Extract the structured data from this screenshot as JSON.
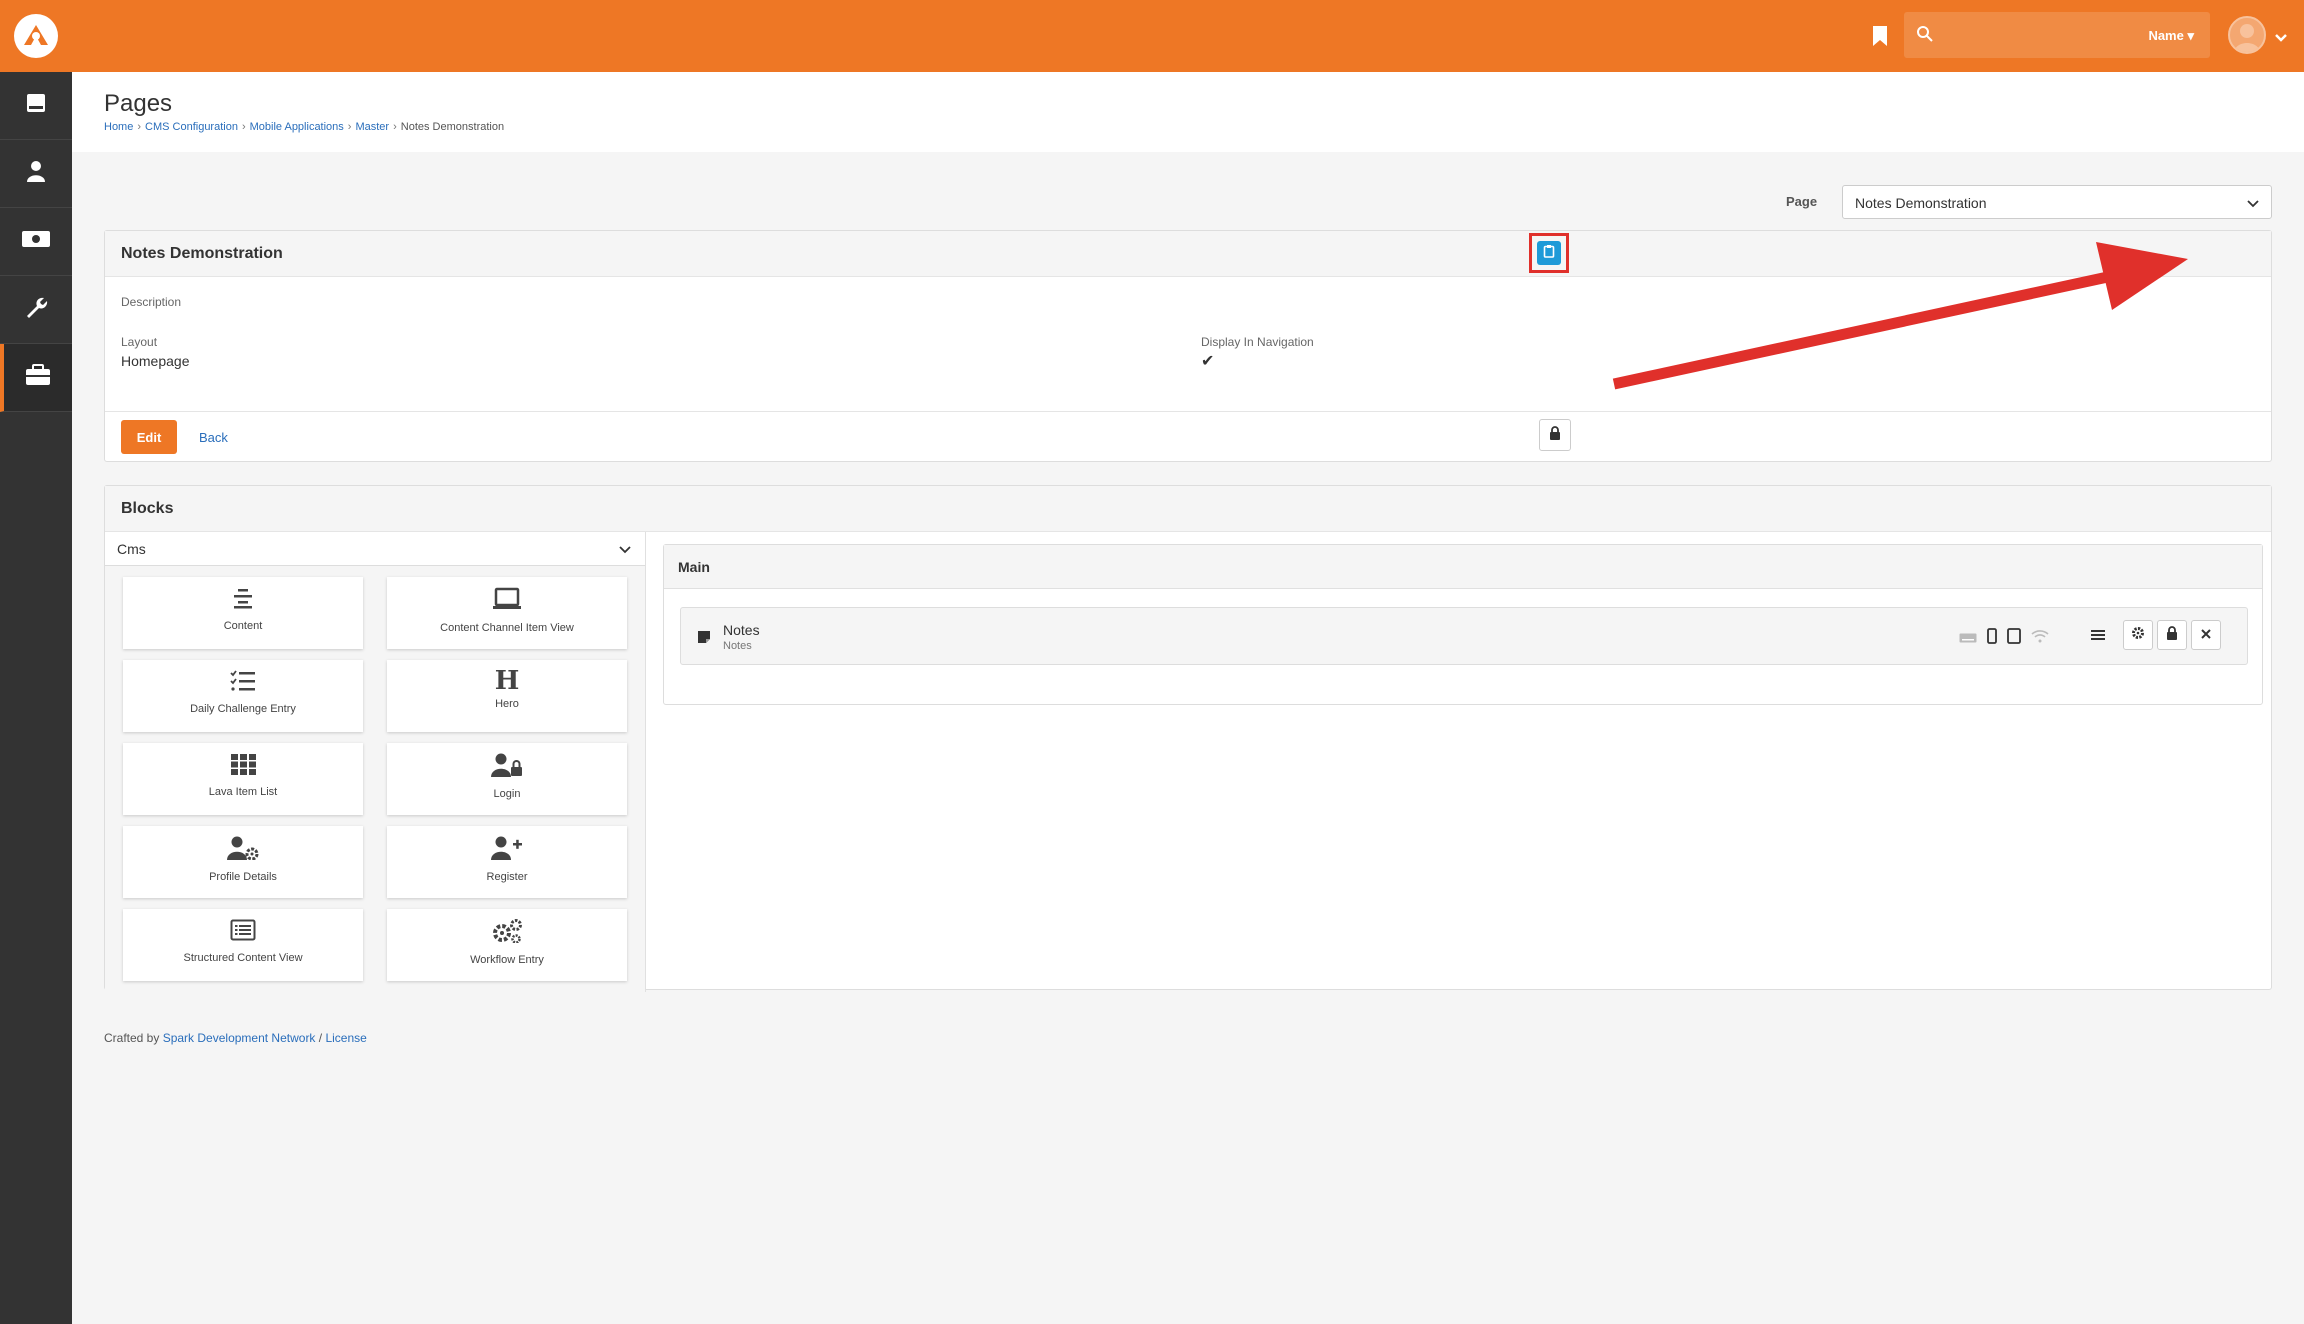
{
  "header": {
    "logo": "rock-logo-icon",
    "search": {
      "placeholder": "",
      "filter_label": "Name"
    },
    "accent_color": "#ee7725"
  },
  "sidebar": {
    "items": [
      {
        "icon": "book-icon"
      },
      {
        "icon": "user-icon"
      },
      {
        "icon": "money-icon"
      },
      {
        "icon": "wrench-icon"
      },
      {
        "icon": "briefcase-icon",
        "active": true
      }
    ]
  },
  "page": {
    "title": "Pages",
    "breadcrumbs": [
      "Home",
      "CMS Configuration",
      "Mobile Applications",
      "Master",
      "Notes Demonstration"
    ]
  },
  "page_picker": {
    "label": "Page",
    "value": "Notes Demonstration"
  },
  "detail": {
    "title": "Notes Demonstration",
    "description_label": "Description",
    "layout_label": "Layout",
    "layout_value": "Homepage",
    "display_nav_label": "Display In Navigation",
    "display_nav_value": "✔",
    "edit_label": "Edit",
    "back_label": "Back"
  },
  "blocks": {
    "title": "Blocks",
    "category": "Cms",
    "block_types": [
      {
        "label": "Content",
        "icon": "align-center-icon"
      },
      {
        "label": "Content Channel Item View",
        "icon": "laptop-icon"
      },
      {
        "label": "Daily Challenge Entry",
        "icon": "checklist-icon"
      },
      {
        "label": "Hero",
        "icon": "heading-icon"
      },
      {
        "label": "Lava Item List",
        "icon": "grid-icon"
      },
      {
        "label": "Login",
        "icon": "user-lock-icon"
      },
      {
        "label": "Profile Details",
        "icon": "user-cog-icon"
      },
      {
        "label": "Register",
        "icon": "user-plus-icon"
      },
      {
        "label": "Structured Content View",
        "icon": "list-alt-icon"
      },
      {
        "label": "Workflow Entry",
        "icon": "cogs-icon"
      }
    ],
    "zone": {
      "name": "Main",
      "block": {
        "name": "Notes",
        "type": "Notes"
      }
    }
  },
  "footer": {
    "prefix": "Crafted by",
    "network": "Spark Development Network",
    "separator": "/",
    "license": "License"
  },
  "annotation": {
    "color": "#e0302b"
  }
}
